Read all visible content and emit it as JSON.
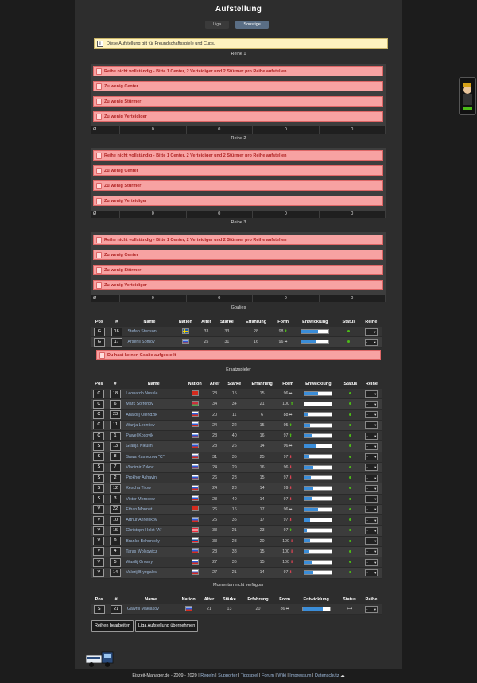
{
  "page": {
    "title": "Aufstellung",
    "tabs": [
      {
        "label": "Liga",
        "active": false
      },
      {
        "label": "Sonstige",
        "active": true
      }
    ],
    "info_note": "Diese Aufstellung gilt für Freundschaftsspiele und Cups."
  },
  "lines": [
    {
      "label": "Reihe 1",
      "errors": [
        "Reihe nicht vollständig - Bitte 1 Center, 2 Verteidiger und 2 Stürmer pro Reihe aufstellen",
        "Zu wenig Center",
        "Zu wenig Stürmer",
        "Zu wenig Verteidiger"
      ],
      "summary": [
        "Ø",
        "0",
        "0",
        "0",
        "0"
      ]
    },
    {
      "label": "Reihe 2",
      "errors": [
        "Reihe nicht vollständig - Bitte 1 Center, 2 Verteidiger und 2 Stürmer pro Reihe aufstellen",
        "Zu wenig Center",
        "Zu wenig Stürmer",
        "Zu wenig Verteidiger"
      ],
      "summary": [
        "Ø",
        "0",
        "0",
        "0",
        "0"
      ]
    },
    {
      "label": "Reihe 3",
      "errors": [
        "Reihe nicht vollständig - Bitte 1 Center, 2 Verteidiger und 2 Stürmer pro Reihe aufstellen",
        "Zu wenig Center",
        "Zu wenig Stürmer",
        "Zu wenig Verteidiger"
      ],
      "summary": [
        "Ø",
        "0",
        "0",
        "0",
        "0"
      ]
    }
  ],
  "columns": [
    "Pos",
    "#",
    "Name",
    "Nation",
    "Alter",
    "Stärke",
    "Erfahrung",
    "Form",
    "Entwicklung",
    "Status",
    "Reihe"
  ],
  "goalies": {
    "label": "Goalies",
    "rows": [
      {
        "pos": "G",
        "num": "16",
        "name": "Stefan Stenson",
        "flag": "se",
        "alter": "33",
        "staerke": "33",
        "erfahrung": "28",
        "form": "98",
        "trend": "up",
        "dev": 0.62,
        "reihe": "-"
      },
      {
        "pos": "G",
        "num": "17",
        "name": "Arsenij Somov",
        "flag": "ru",
        "alter": "25",
        "staerke": "31",
        "erfahrung": "16",
        "form": "96",
        "trend": "side",
        "dev": 0.55,
        "reihe": "-"
      }
    ],
    "error": "Du hast keinen Goalie aufgestellt"
  },
  "subs": {
    "label": "Ersatzspieler",
    "rows": [
      {
        "pos": "C",
        "num": "18",
        "name": "Leonardo Nussle",
        "flag": "ch",
        "alter": "28",
        "staerke": "15",
        "erfahrung": "15",
        "form": "96",
        "trend": "side",
        "dev": 0.48,
        "reihe": "-"
      },
      {
        "pos": "C",
        "num": "6",
        "name": "Mark Sofronov",
        "flag": "by",
        "alter": "34",
        "staerke": "34",
        "erfahrung": "21",
        "form": "100",
        "trend": "up",
        "dev": 0.0,
        "reihe": "-"
      },
      {
        "pos": "C",
        "num": "23",
        "name": "Anatolij Olendzik",
        "flag": "ru",
        "alter": "20",
        "staerke": "11",
        "erfahrung": "6",
        "form": "88",
        "trend": "side",
        "dev": 0.1,
        "reihe": "-"
      },
      {
        "pos": "C",
        "num": "11",
        "name": "Wanja Leontiev",
        "flag": "ru",
        "alter": "24",
        "staerke": "22",
        "erfahrung": "15",
        "form": "95",
        "trend": "up",
        "dev": 0.2,
        "reihe": "-"
      },
      {
        "pos": "C",
        "num": "1",
        "name": "Pawel Kosovik",
        "flag": "ru",
        "alter": "28",
        "staerke": "40",
        "erfahrung": "16",
        "form": "97",
        "trend": "up",
        "dev": 0.25,
        "reihe": "-"
      },
      {
        "pos": "S",
        "num": "13",
        "name": "Granja Nikulin",
        "flag": "ru",
        "alter": "28",
        "staerke": "26",
        "erfahrung": "14",
        "form": "96",
        "trend": "side",
        "dev": 0.4,
        "reihe": "-"
      },
      {
        "pos": "S",
        "num": "8",
        "name": "Sawa Kusnezow \"C\"",
        "flag": "ru",
        "alter": "31",
        "staerke": "35",
        "erfahrung": "25",
        "form": "97",
        "trend": "down",
        "dev": 0.18,
        "reihe": "-"
      },
      {
        "pos": "S",
        "num": "7",
        "name": "Vladimir Zukov",
        "flag": "ru",
        "alter": "24",
        "staerke": "29",
        "erfahrung": "16",
        "form": "96",
        "trend": "down",
        "dev": 0.32,
        "reihe": "-"
      },
      {
        "pos": "S",
        "num": "2",
        "name": "Prokhor Ashavin",
        "flag": "ru",
        "alter": "26",
        "staerke": "28",
        "erfahrung": "15",
        "form": "97",
        "trend": "down",
        "dev": 0.22,
        "reihe": "-"
      },
      {
        "pos": "S",
        "num": "12",
        "name": "Kescha Titow",
        "flag": "ru",
        "alter": "24",
        "staerke": "23",
        "erfahrung": "14",
        "form": "99",
        "trend": "down",
        "dev": 0.3,
        "reihe": "-"
      },
      {
        "pos": "S",
        "num": "3",
        "name": "Viktor Morosow",
        "flag": "ru",
        "alter": "28",
        "staerke": "40",
        "erfahrung": "14",
        "form": "97",
        "trend": "down",
        "dev": 0.28,
        "reihe": "-"
      },
      {
        "pos": "V",
        "num": "22",
        "name": "Ethan Monnet",
        "flag": "ch",
        "alter": "26",
        "staerke": "16",
        "erfahrung": "17",
        "form": "96",
        "trend": "side",
        "dev": 0.5,
        "reihe": "-"
      },
      {
        "pos": "V",
        "num": "10",
        "name": "Arthur Annenkov",
        "flag": "ru",
        "alter": "25",
        "staerke": "35",
        "erfahrung": "17",
        "form": "97",
        "trend": "down",
        "dev": 0.2,
        "reihe": "-"
      },
      {
        "pos": "V",
        "num": "15",
        "name": "Christoph Holst \"A\"",
        "flag": "at",
        "alter": "33",
        "staerke": "21",
        "erfahrung": "23",
        "form": "97",
        "trend": "up",
        "dev": 0.08,
        "reihe": "-"
      },
      {
        "pos": "V",
        "num": "9",
        "name": "Branko Bohunicky",
        "flag": "sk",
        "alter": "33",
        "staerke": "28",
        "erfahrung": "20",
        "form": "100",
        "trend": "down",
        "dev": 0.2,
        "reihe": "-"
      },
      {
        "pos": "V",
        "num": "4",
        "name": "Taras Wolkowicz",
        "flag": "ru",
        "alter": "28",
        "staerke": "38",
        "erfahrung": "15",
        "form": "100",
        "trend": "down",
        "dev": 0.18,
        "reihe": "-"
      },
      {
        "pos": "V",
        "num": "5",
        "name": "Wasilij Grosny",
        "flag": "ru",
        "alter": "27",
        "staerke": "36",
        "erfahrung": "15",
        "form": "100",
        "trend": "down",
        "dev": 0.25,
        "reihe": "-"
      },
      {
        "pos": "V",
        "num": "14",
        "name": "Valerij Bryzgalov",
        "flag": "ru",
        "alter": "27",
        "staerke": "21",
        "erfahrung": "14",
        "form": "97",
        "trend": "down",
        "dev": 0.3,
        "reihe": "-"
      }
    ]
  },
  "unavailable": {
    "label": "Momentan nicht verfügbar",
    "rows": [
      {
        "pos": "S",
        "num": "21",
        "name": "Gawrill Maklakov",
        "flag": "ru",
        "alter": "21",
        "staerke": "13",
        "erfahrung": "20",
        "form": "86",
        "trend": "side",
        "dev": 0.75,
        "status": "injury",
        "reihe": "-"
      }
    ]
  },
  "buttons": {
    "edit": "Reihen bearbeiten",
    "apply": "Liga Aufstellung übernehmen"
  },
  "footer": {
    "copyright": "Eiszeit-Manager.de - 2009 - 2020 |",
    "links": [
      "Regeln",
      "Supporter",
      "Tippspiel",
      "Forum",
      "Wiki",
      "Impressum",
      "Datenschutz"
    ]
  },
  "colors": {
    "error_bg": "#f7a2a2",
    "error_text": "#b02525",
    "accent": "#3b8dd8",
    "link": "#9db8d9",
    "note_bg": "#fff3bf"
  }
}
